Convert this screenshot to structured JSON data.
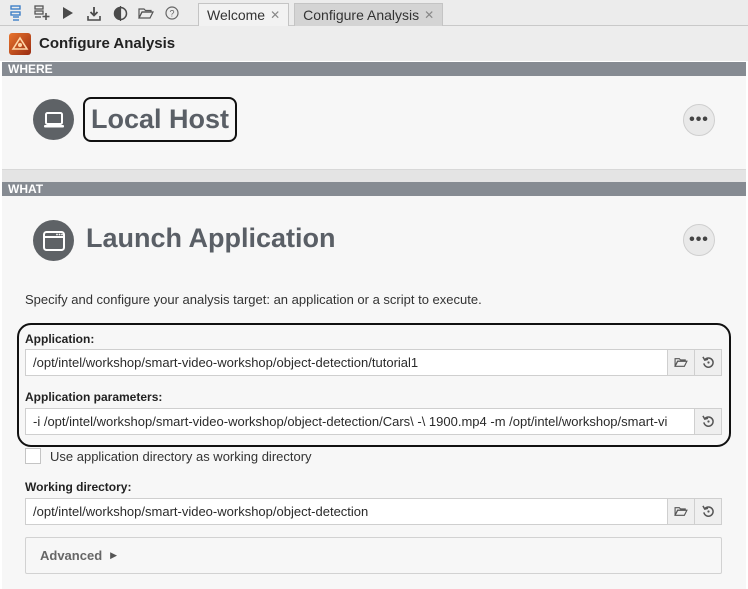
{
  "toolbar": {
    "icons": [
      "new-project-icon",
      "new-analysis-icon",
      "run-icon",
      "download-icon",
      "compare-icon",
      "open-folder-icon",
      "help-icon"
    ]
  },
  "tabs": [
    {
      "label": "Welcome",
      "active": false
    },
    {
      "label": "Configure Analysis",
      "active": true
    }
  ],
  "header": {
    "title": "Configure Analysis"
  },
  "where": {
    "section_label": "WHERE",
    "host": "Local Host"
  },
  "what": {
    "section_label": "WHAT",
    "title": "Launch Application",
    "description": "Specify and configure your analysis target: an application or a script to execute.",
    "application_label": "Application:",
    "application_value": "/opt/intel/workshop/smart-video-workshop/object-detection/tutorial1",
    "params_label": "Application parameters:",
    "params_value": "-i /opt/intel/workshop/smart-video-workshop/object-detection/Cars\\ -\\ 1900.mp4 -m /opt/intel/workshop/smart-vi",
    "use_app_dir_label": "Use application directory as working directory",
    "use_app_dir_checked": false,
    "working_dir_label": "Working directory:",
    "working_dir_value": "/opt/intel/workshop/smart-video-workshop/object-detection",
    "advanced_label": "Advanced"
  },
  "colors": {
    "section_bar": "#868b92",
    "title_gray": "#5a5f66",
    "icon_circle": "#5e6266"
  }
}
